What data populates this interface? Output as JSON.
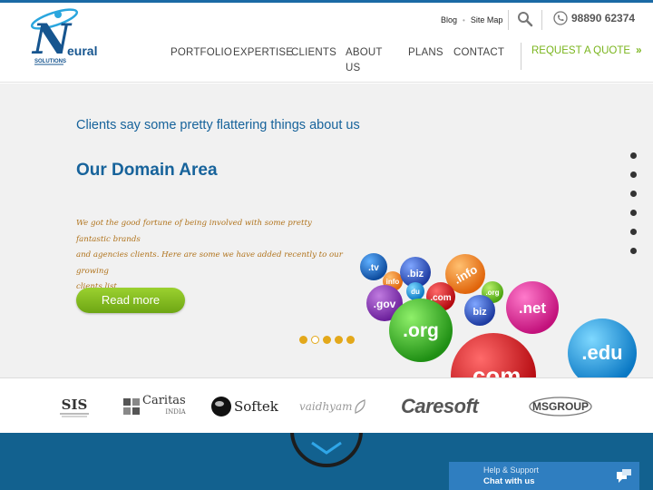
{
  "brand": {
    "logo_letter": "N",
    "logo_word": "eural",
    "logo_sub": "SOLUTIONS",
    "accent": "#17639b",
    "green": "#7ab51d",
    "gold": "#e3a81a"
  },
  "utility": {
    "blog": "Blog",
    "sitemap": "Site Map",
    "phone": "98890 62374",
    "icons": [
      "search-icon",
      "phone-icon"
    ]
  },
  "nav": {
    "portfolio": "PORTFOLIO",
    "expertise": "EXPERTISE",
    "clients": "CLIENTS",
    "about_1": "ABOUT",
    "about_2": "US",
    "plans": "PLANS",
    "contact": "CONTACT",
    "quote": "REQUEST A QUOTE",
    "quote_chevron": "»"
  },
  "hero": {
    "tagline": "Clients say some pretty flattering things about us",
    "title": "Our Domain Area",
    "text_1": "We got the good fortune of being involved with some pretty fantastic brands",
    "text_2": "and agencies clients. Here are some we have added recently to our growing",
    "text_3": "clients list.",
    "read_more": "Read more",
    "slides": 5,
    "active_slide": 2,
    "side_dots": 6,
    "domain_balls": {
      "tv": ".tv",
      "info_small": "info",
      "biz_a": ".biz",
      "info_big": ".info",
      "gov": ".gov",
      "du": "du",
      "com_small": ".com",
      "org_small": ".org",
      "biz_b": "biz",
      "net": ".net",
      "org": ".org",
      "com": ".com",
      "edu": ".edu"
    }
  },
  "clients": {
    "sis": "SIS",
    "caritas": "Caritas",
    "caritas_sub": "INDIA",
    "softek": "Softek",
    "vaidhyam": "vaidhyam",
    "caresoft": "Caresoft",
    "msgroup": "MSGROUP"
  },
  "chat": {
    "line1": "Help & Support",
    "line2": "Chat with us"
  }
}
